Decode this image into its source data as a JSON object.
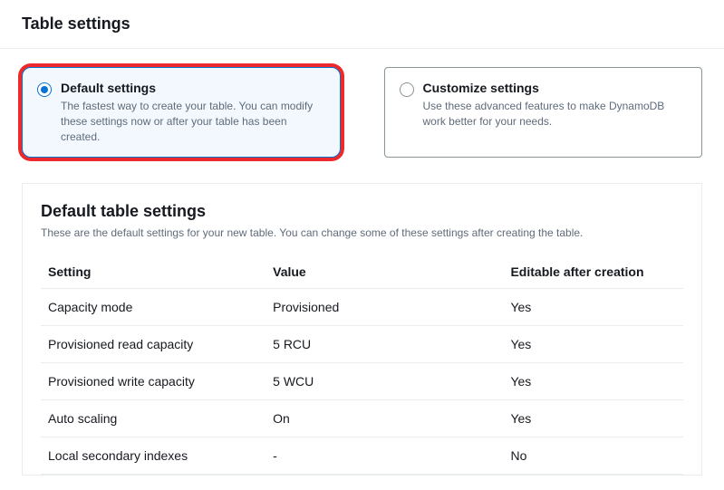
{
  "header": {
    "title": "Table settings"
  },
  "options": {
    "default": {
      "title": "Default settings",
      "desc": "The fastest way to create your table. You can modify these settings now or after your table has been created."
    },
    "customize": {
      "title": "Customize settings",
      "desc": "Use these advanced features to make DynamoDB work better for your needs."
    }
  },
  "panel": {
    "title": "Default table settings",
    "desc": "These are the default settings for your new table. You can change some of these settings after creating the table."
  },
  "table": {
    "headers": {
      "setting": "Setting",
      "value": "Value",
      "editable": "Editable after creation"
    },
    "rows": [
      {
        "setting": "Capacity mode",
        "value": "Provisioned",
        "editable": "Yes"
      },
      {
        "setting": "Provisioned read capacity",
        "value": "5 RCU",
        "editable": "Yes"
      },
      {
        "setting": "Provisioned write capacity",
        "value": "5 WCU",
        "editable": "Yes"
      },
      {
        "setting": "Auto scaling",
        "value": "On",
        "editable": "Yes"
      },
      {
        "setting": "Local secondary indexes",
        "value": "-",
        "editable": "No"
      }
    ]
  }
}
